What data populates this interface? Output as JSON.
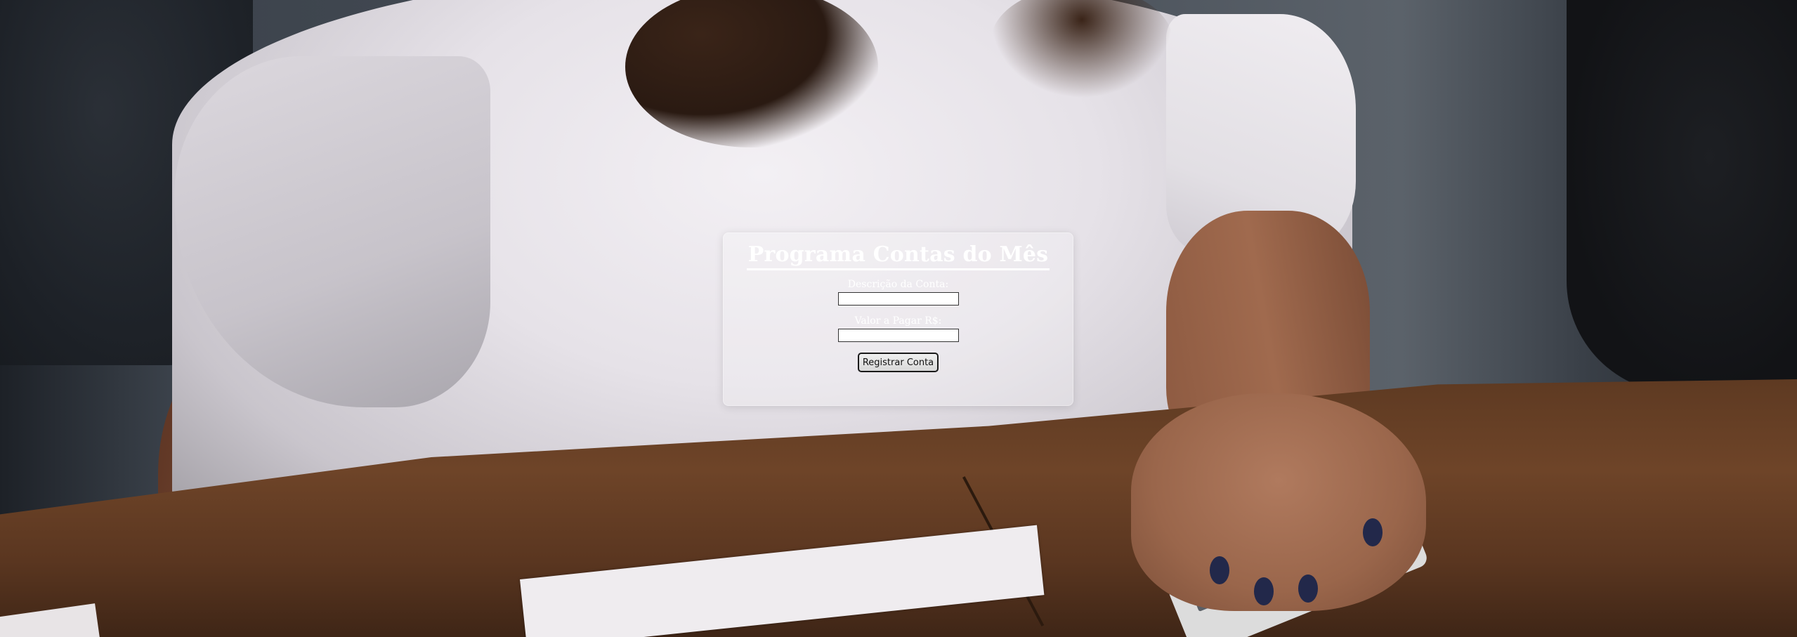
{
  "form": {
    "title": "Programa Contas do Mês",
    "description_label": "Descrição da Conta:",
    "description_value": "",
    "amount_label": "Valor a Pagar R$:",
    "amount_value": "",
    "submit_label": "Registrar Conta"
  },
  "colors": {
    "card_background": "rgba(255,255,255,0.22)",
    "title_text": "#ffffff",
    "label_text": "#ffffff"
  }
}
